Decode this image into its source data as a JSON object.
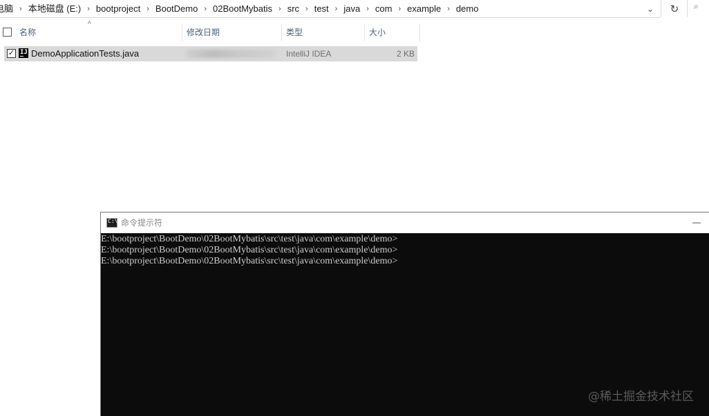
{
  "breadcrumb": [
    "电脑",
    "本地磁盘 (E:)",
    "bootproject",
    "BootDemo",
    "02BootMybatis",
    "src",
    "test",
    "java",
    "com",
    "example",
    "demo"
  ],
  "breadcrumb_separator": "›",
  "toolbar": {
    "dropdown_icon": "chevron-down-icon",
    "refresh_icon": "refresh-icon",
    "refresh_glyph": "↻",
    "dropdown_glyph": "⌄",
    "search_glyph": "⌕"
  },
  "columns": {
    "name": "名称",
    "modified": "修改日期",
    "type": "类型",
    "size": "大小"
  },
  "files": [
    {
      "name": "DemoApplicationTests.java",
      "icon": "intellij-java-file-icon",
      "icon_text": "IJ",
      "type": "IntelliJ IDEA",
      "size": "2 KB",
      "selected": true,
      "checked": true
    }
  ],
  "cmd": {
    "title": "命令提示符",
    "minimize_glyph": "—",
    "lines": [
      "E:\\bootproject\\BootDemo\\02BootMybatis\\src\\test\\java\\com\\example\\demo>",
      "E:\\bootproject\\BootDemo\\02BootMybatis\\src\\test\\java\\com\\example\\demo>",
      "E:\\bootproject\\BootDemo\\02BootMybatis\\src\\test\\java\\com\\example\\demo>"
    ]
  },
  "watermark": "@稀土掘金技术社区",
  "colors": {
    "selected_row": "#d9d9d9",
    "console_bg": "#0c0c0c",
    "console_text": "#cccccc",
    "header_text": "#4c607a"
  }
}
